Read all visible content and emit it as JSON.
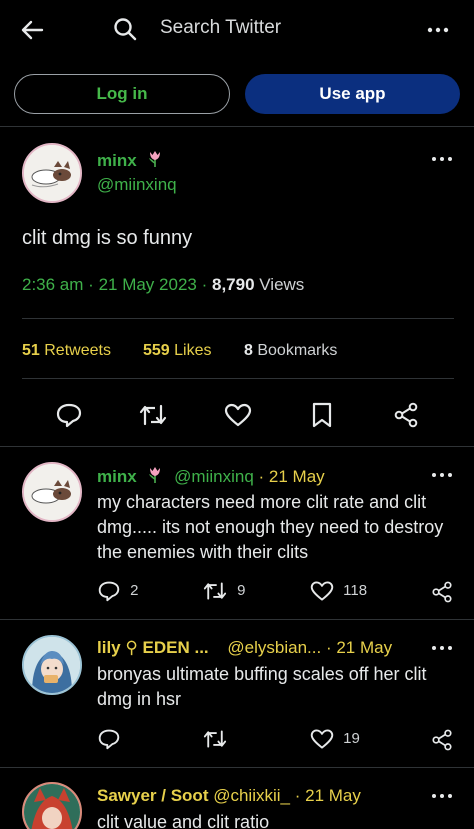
{
  "topbar": {
    "search_placeholder": "Search Twitter"
  },
  "auth": {
    "login_label": "Log in",
    "app_label": "Use app"
  },
  "tweet": {
    "author_name": "minx",
    "author_handle": "@miinxinq",
    "text": "clit dmg is so funny",
    "time": "2:36 am",
    "date": "21 May 2023",
    "views_count": "8,790",
    "views_label": "Views",
    "retweets_count": "51",
    "retweets_label": "Retweets",
    "likes_count": "559",
    "likes_label": "Likes",
    "bookmarks_count": "8",
    "bookmarks_label": "Bookmarks"
  },
  "replies": [
    {
      "name": "minx",
      "handle": "@miinxinq",
      "date": "21 May",
      "text": "my characters need more clit rate and clit dmg..... its not enough they need to destroy the enemies with their clits",
      "replies": "2",
      "retweets": "9",
      "likes": "118"
    },
    {
      "name": "lily ⚲ EDEN ...",
      "handle": "@elysbian...",
      "date": "21 May",
      "text": "bronyas ultimate buffing scales off her clit dmg in hsr",
      "replies": "",
      "retweets": "",
      "likes": "19"
    },
    {
      "name": "Sawyer / Soot",
      "handle": "@chiixkii_",
      "date": "21 May",
      "text": "clit value and clit ratio"
    }
  ],
  "colors": {
    "accent_green": "#3fb14a",
    "accent_yellow": "#e7d04b",
    "app_button": "#0b2f7f"
  }
}
